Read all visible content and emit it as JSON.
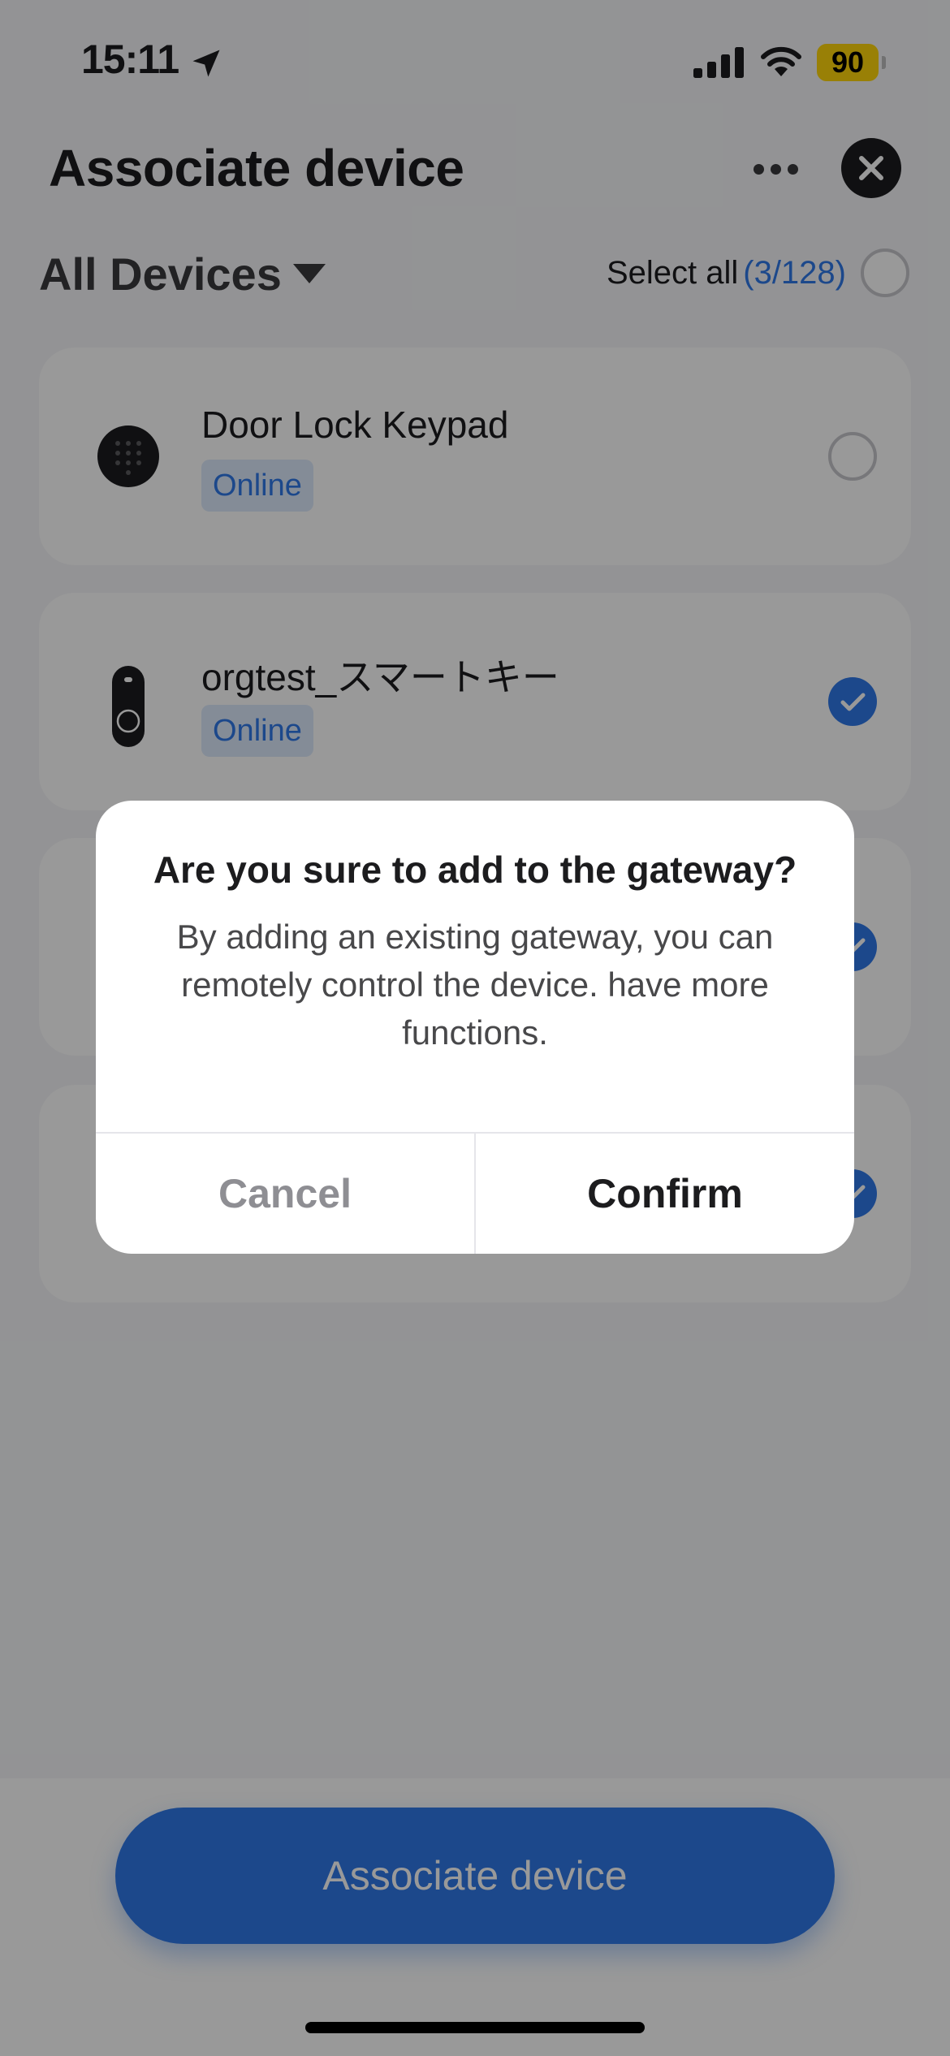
{
  "status_bar": {
    "time": "15:11",
    "battery": "90",
    "icons": [
      "location-arrow-icon",
      "cellular-signal-icon",
      "wifi-icon",
      "battery-icon"
    ]
  },
  "header": {
    "title": "Associate device",
    "more_icon": "ellipsis-icon",
    "close_icon": "close-icon"
  },
  "filter": {
    "label": "All Devices",
    "icon": "caret-down-icon",
    "select_all_label": "Select all",
    "select_all_count": "(3/128)",
    "select_all_checked": false
  },
  "devices": [
    {
      "name": "Door Lock Keypad",
      "status": "Online",
      "icon": "keypad-icon",
      "checked": false
    },
    {
      "name": "orgtest_スマートキー",
      "status": "Online",
      "icon": "smart-key-fob-icon",
      "checked": true
    },
    {
      "name": "",
      "status": "",
      "icon": "lock-icon",
      "checked": true
    },
    {
      "name": "",
      "status": "",
      "icon": "",
      "checked": true
    }
  ],
  "bottom": {
    "associate_label": "Associate device"
  },
  "dialog": {
    "title": "Are you sure to add to the gateway?",
    "message": "By adding an existing gateway, you can remotely control the device. have more functions.",
    "cancel_label": "Cancel",
    "confirm_label": "Confirm"
  },
  "colors": {
    "accent": "#2f78e8",
    "badge_bg": "#dde9fc",
    "overlay": "rgba(0,0,0,0.40)",
    "battery": "#ffd60a"
  }
}
